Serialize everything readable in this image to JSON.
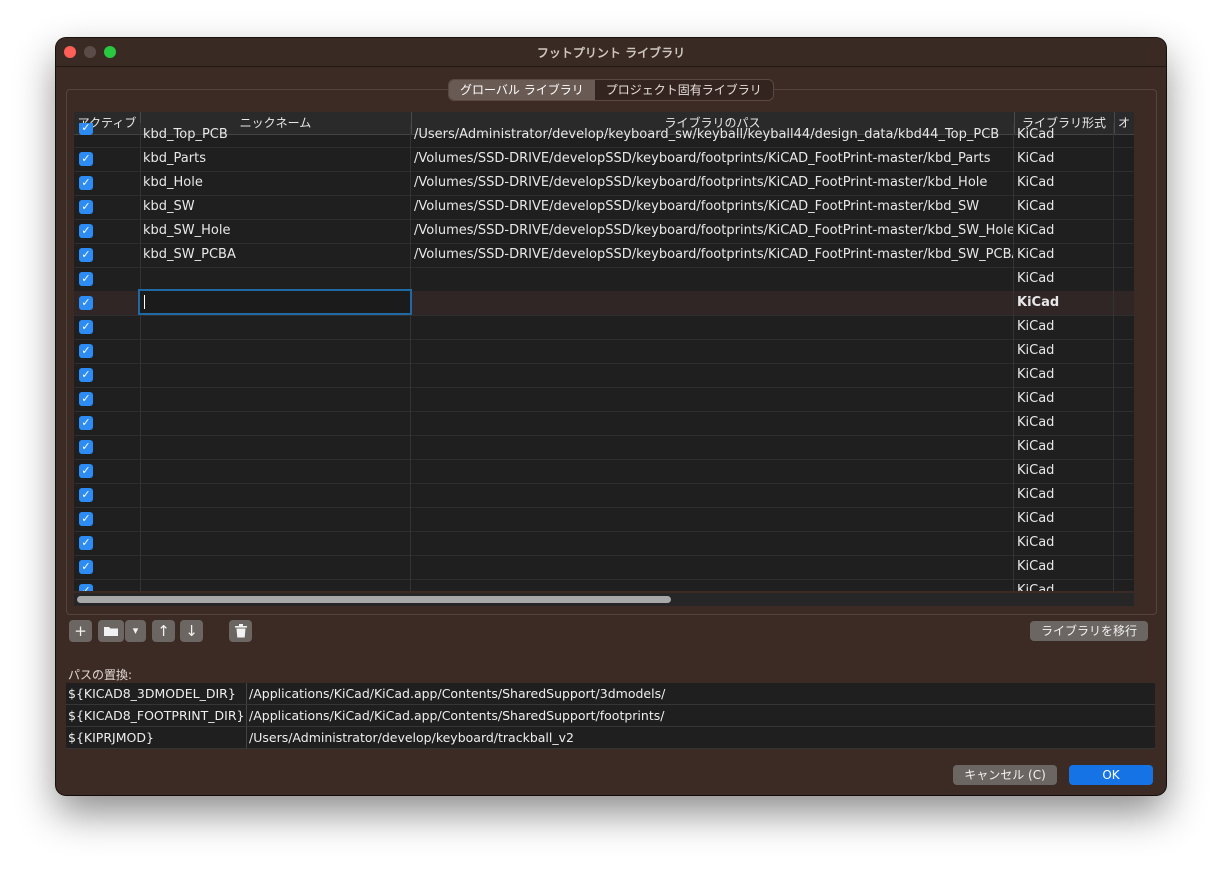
{
  "window": {
    "title": "フットプリント ライブラリ"
  },
  "tabs": [
    {
      "label": "グローバル ライブラリ",
      "active": true
    },
    {
      "label": "プロジェクト固有ライブラリ",
      "active": false
    }
  ],
  "table": {
    "headers": {
      "active": "アクティブ",
      "nickname": "ニックネーム",
      "path": "ライブラリのパス",
      "type": "ライブラリ形式",
      "options": "オ"
    },
    "partial_row": {
      "nickname": "kbd_Top_PCB",
      "path": "/Users/Administrator/develop/keyboard_sw/keyball/keyball44/design_data/kbd44_Top_PCB",
      "type": "KiCad"
    },
    "rows": [
      {
        "active": true,
        "nickname": "kbd_Parts",
        "path": "/Volumes/SSD-DRIVE/developSSD/keyboard/footprints/KiCAD_FootPrint-master/kbd_Parts",
        "type": "KiCad"
      },
      {
        "active": true,
        "nickname": "kbd_Hole",
        "path": "/Volumes/SSD-DRIVE/developSSD/keyboard/footprints/KiCAD_FootPrint-master/kbd_Hole",
        "type": "KiCad"
      },
      {
        "active": true,
        "nickname": "kbd_SW",
        "path": "/Volumes/SSD-DRIVE/developSSD/keyboard/footprints/KiCAD_FootPrint-master/kbd_SW",
        "type": "KiCad"
      },
      {
        "active": true,
        "nickname": "kbd_SW_Hole",
        "path": "/Volumes/SSD-DRIVE/developSSD/keyboard/footprints/KiCAD_FootPrint-master/kbd_SW_Hole",
        "type": "KiCad"
      },
      {
        "active": true,
        "nickname": "kbd_SW_PCBA",
        "path": "/Volumes/SSD-DRIVE/developSSD/keyboard/footprints/KiCAD_FootPrint-master/kbd_SW_PCBA",
        "type": "KiCad"
      },
      {
        "active": true,
        "nickname": "",
        "path": "",
        "type": "KiCad"
      },
      {
        "active": true,
        "nickname": "",
        "path": "",
        "type": "KiCad",
        "selected": true,
        "editing": true
      },
      {
        "active": true,
        "nickname": "",
        "path": "",
        "type": "KiCad"
      },
      {
        "active": true,
        "nickname": "",
        "path": "",
        "type": "KiCad"
      },
      {
        "active": true,
        "nickname": "",
        "path": "",
        "type": "KiCad"
      },
      {
        "active": true,
        "nickname": "",
        "path": "",
        "type": "KiCad"
      },
      {
        "active": true,
        "nickname": "",
        "path": "",
        "type": "KiCad"
      },
      {
        "active": true,
        "nickname": "",
        "path": "",
        "type": "KiCad"
      },
      {
        "active": true,
        "nickname": "",
        "path": "",
        "type": "KiCad"
      },
      {
        "active": true,
        "nickname": "",
        "path": "",
        "type": "KiCad"
      },
      {
        "active": true,
        "nickname": "",
        "path": "",
        "type": "KiCad"
      },
      {
        "active": true,
        "nickname": "",
        "path": "",
        "type": "KiCad"
      },
      {
        "active": true,
        "nickname": "",
        "path": "",
        "type": "KiCad"
      },
      {
        "active": true,
        "nickname": "",
        "path": "",
        "type": "KiCad"
      }
    ]
  },
  "toolbar": {
    "add": "+",
    "folder": "folder-icon",
    "dropdown": "▾",
    "up": "↑",
    "down": "↓",
    "delete": "trash-icon",
    "migrate_label": "ライブラリを移行"
  },
  "path_substitutions": {
    "label": "パスの置換:",
    "rows": [
      {
        "var": "${KICAD8_3DMODEL_DIR}",
        "value": "/Applications/KiCad/KiCad.app/Contents/SharedSupport/3dmodels/"
      },
      {
        "var": "${KICAD8_FOOTPRINT_DIR}",
        "value": "/Applications/KiCad/KiCad.app/Contents/SharedSupport/footprints/"
      },
      {
        "var": "${KIPRJMOD}",
        "value": "/Users/Administrator/develop/keyboard/trackball_v2"
      }
    ]
  },
  "buttons": {
    "cancel": "キャンセル (C)",
    "ok": "OK"
  },
  "colors": {
    "window_bg": "#3c2b25",
    "accent": "#1673e6",
    "checkbox": "#2c8cf4"
  }
}
